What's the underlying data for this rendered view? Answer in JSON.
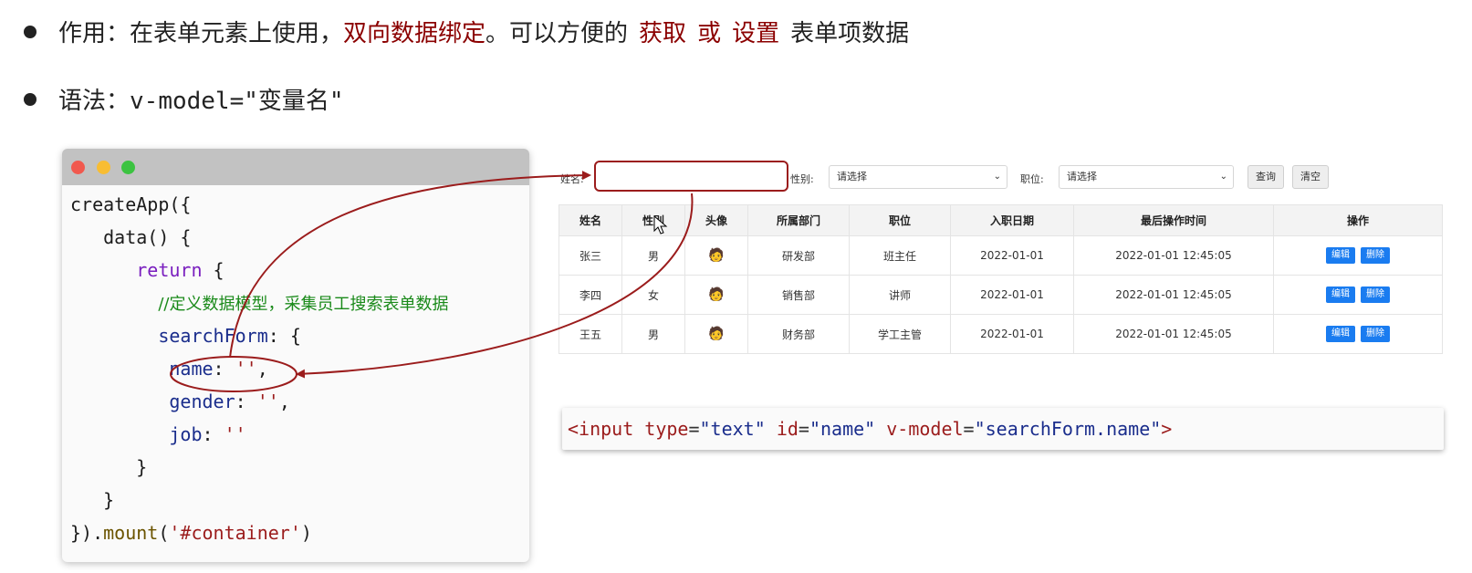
{
  "bullets": {
    "b1": {
      "prefix": "作用：在表单元素上使用，",
      "red1": "双向数据绑定",
      "mid": "。可以方便的",
      "red2": "获取",
      "red3": "或",
      "red4": "设置",
      "suffix": "表单项数据"
    },
    "b2": {
      "prefix": "语法：",
      "code": "v-model=\"变量名\""
    }
  },
  "code_window": {
    "lines": [
      {
        "a": "createApp({"
      },
      {
        "a": "   data() {"
      },
      {
        "kw": "return",
        "b": " {"
      },
      {
        "comment": "//定义数据模型，采集员工搜索表单数据"
      },
      {
        "prop": "searchForm",
        "b": ": {"
      },
      {
        "prop": "name",
        "b": ": ",
        "str": "''",
        "c": ","
      },
      {
        "prop": "gender",
        "b": ": ",
        "str": "''",
        "c": ","
      },
      {
        "prop": "job",
        "b": ": ",
        "str": "''"
      },
      {
        "a": "      }"
      },
      {
        "a": "   }"
      },
      {
        "a": "}).",
        "fn": "mount",
        "b": "(",
        "str": "'#container'",
        "c": ")"
      }
    ]
  },
  "search": {
    "name_label": "姓名:",
    "gender_label": "性别:",
    "gender_placeholder": "请选择",
    "job_label": "职位:",
    "job_placeholder": "请选择",
    "query_button": "查询",
    "clear_button": "清空"
  },
  "table": {
    "headers": [
      "姓名",
      "性别",
      "头像",
      "所属部门",
      "职位",
      "入职日期",
      "最后操作时间",
      "操作"
    ],
    "rows": [
      {
        "name": "张三",
        "gender": "男",
        "dept": "研发部",
        "job": "班主任",
        "entry": "2022-01-01",
        "updated": "2022-01-01 12:45:05"
      },
      {
        "name": "李四",
        "gender": "女",
        "dept": "销售部",
        "job": "讲师",
        "entry": "2022-01-01",
        "updated": "2022-01-01 12:45:05"
      },
      {
        "name": "王五",
        "gender": "男",
        "dept": "财务部",
        "job": "学工主管",
        "entry": "2022-01-01",
        "updated": "2022-01-01 12:45:05"
      }
    ],
    "edit_label": "编辑",
    "delete_label": "删除",
    "avatar_icon": "person-avatar-icon"
  },
  "code_bar": {
    "open": "<input",
    "attr1": "type",
    "val1": "\"text\"",
    "attr2": "id",
    "val2": "\"name\"",
    "attr3": "v-model",
    "val3": "\"searchForm.name\"",
    "close": ">"
  },
  "colors": {
    "accent_red": "#8b0000",
    "button_blue": "#1a7cf0"
  }
}
